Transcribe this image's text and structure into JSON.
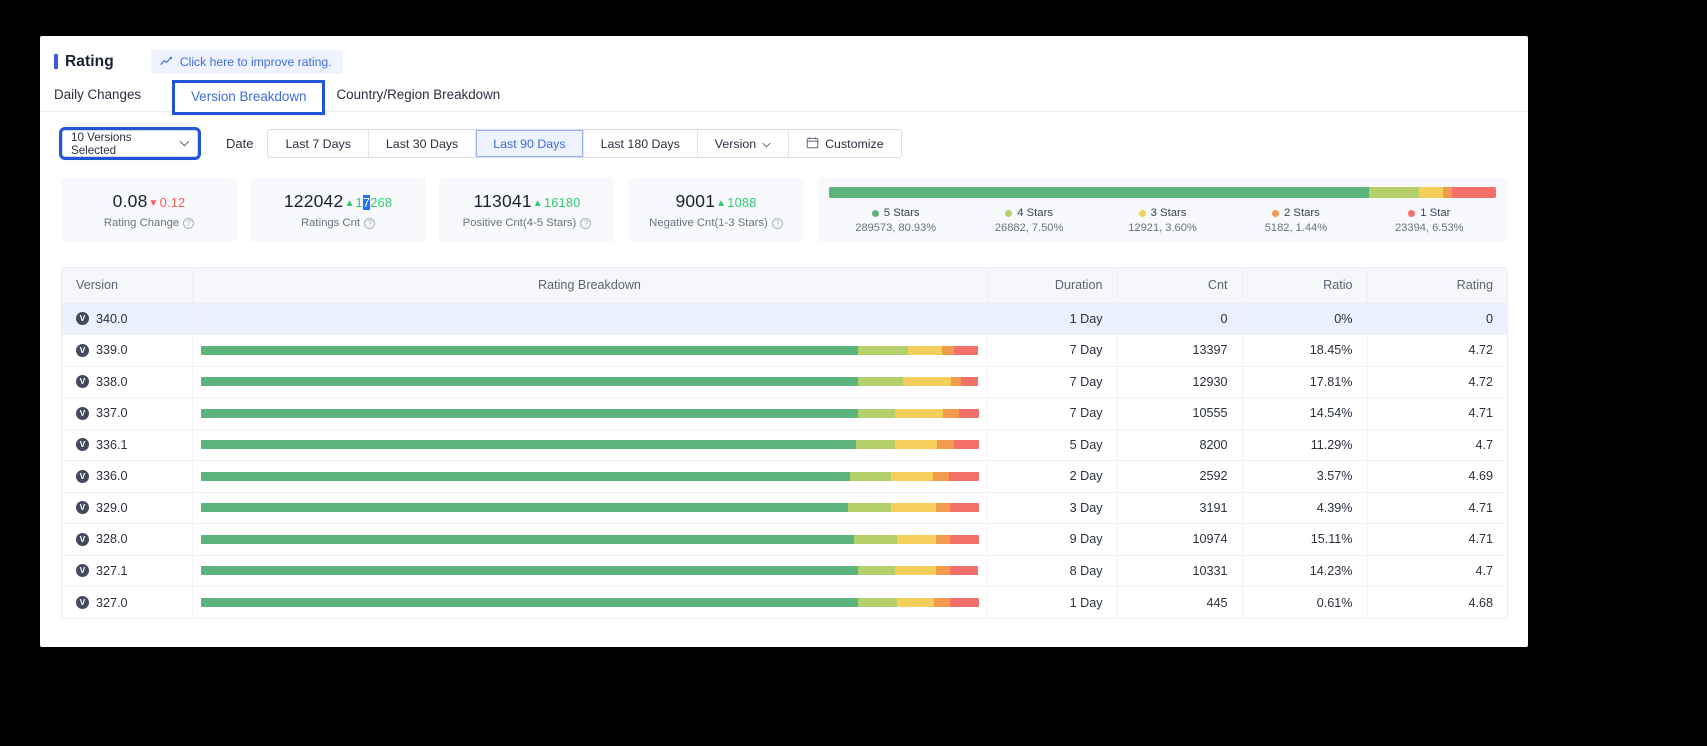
{
  "header": {
    "title": "Rating",
    "improve_cta": "Click here to improve rating.",
    "improve_icon": "line-chart-icon"
  },
  "tabs": [
    {
      "label": "Daily Changes",
      "selected": false
    },
    {
      "label": "Version Breakdown",
      "selected": true
    },
    {
      "label": "Country/Region Breakdown",
      "selected": false
    }
  ],
  "filters": {
    "version_select_value": "10 Versions Selected",
    "chevron_icon": "chevron-down-icon",
    "date_label": "Date",
    "ranges": [
      {
        "label": "Last 7 Days",
        "active": false
      },
      {
        "label": "Last 30 Days",
        "active": false
      },
      {
        "label": "Last 90 Days",
        "active": true
      },
      {
        "label": "Last 180 Days",
        "active": false
      },
      {
        "label": "Version",
        "active": false,
        "caret": "⌄"
      },
      {
        "label": "Customize",
        "active": false,
        "icon": "calendar-icon"
      }
    ]
  },
  "kpis": [
    {
      "value": "0.08",
      "delta": "0.12",
      "direction": "down",
      "arrow": "▼",
      "label": "Rating Change",
      "help_icon": "question-icon"
    },
    {
      "value": "122042",
      "delta_pre": "1",
      "delta_sel": "7",
      "delta_post": "268",
      "direction": "up",
      "arrow": "▲",
      "label": "Ratings Cnt",
      "help_icon": "question-icon"
    },
    {
      "value": "113041",
      "delta": "16180",
      "direction": "up",
      "arrow": "▲",
      "label": "Positive Cnt(4-5 Stars)",
      "help_icon": "question-icon"
    },
    {
      "value": "9001",
      "delta": "1088",
      "direction": "up",
      "arrow": "▲",
      "label": "Negative Cnt(1-3 Stars)",
      "help_icon": "question-icon"
    }
  ],
  "stars": {
    "items": [
      {
        "label": "5 Stars",
        "sub": "289573, 80.93%",
        "pct": 80.93,
        "color": "#5cb47c"
      },
      {
        "label": "4 Stars",
        "sub": "26882, 7.50%",
        "pct": 7.5,
        "color": "#b5cf6b"
      },
      {
        "label": "3 Stars",
        "sub": "12921, 3.60%",
        "pct": 3.6,
        "color": "#f5cf5b"
      },
      {
        "label": "2 Stars",
        "sub": "5182, 1.44%",
        "pct": 1.44,
        "color": "#f29a4d"
      },
      {
        "label": "1 Star",
        "sub": "23394, 6.53%",
        "pct": 6.53,
        "color": "#f4706b"
      }
    ]
  },
  "table": {
    "columns": [
      "Version",
      "Rating Breakdown",
      "Duration",
      "Cnt",
      "Ratio",
      "Rating"
    ],
    "version_badge": "V",
    "rows": [
      {
        "version": "340.0",
        "dist": [
          0,
          0,
          0,
          0,
          0
        ],
        "duration": "1 Day",
        "cnt": "0",
        "ratio": "0%",
        "rating": "0",
        "highlight": true
      },
      {
        "version": "339.0",
        "dist": [
          84.5,
          6.5,
          4.3,
          1.5,
          3.2
        ],
        "duration": "7 Day",
        "cnt": "13397",
        "ratio": "18.45%",
        "rating": "4.72",
        "highlight": false
      },
      {
        "version": "338.0",
        "dist": [
          84.5,
          5.8,
          6.2,
          1.3,
          2.2
        ],
        "duration": "7 Day",
        "cnt": "12930",
        "ratio": "17.81%",
        "rating": "4.72",
        "highlight": false
      },
      {
        "version": "337.0",
        "dist": [
          84.5,
          4.8,
          6.2,
          2.0,
          2.5
        ],
        "duration": "7 Day",
        "cnt": "10555",
        "ratio": "14.54%",
        "rating": "4.71",
        "highlight": false
      },
      {
        "version": "336.1",
        "dist": [
          84.3,
          5.0,
          5.3,
          2.2,
          3.2
        ],
        "duration": "5 Day",
        "cnt": "8200",
        "ratio": "11.29%",
        "rating": "4.7",
        "highlight": false
      },
      {
        "version": "336.0",
        "dist": [
          83.5,
          5.2,
          5.5,
          2.0,
          3.8
        ],
        "duration": "2 Day",
        "cnt": "2592",
        "ratio": "3.57%",
        "rating": "4.69",
        "highlight": false
      },
      {
        "version": "329.0",
        "dist": [
          83.2,
          5.5,
          5.8,
          1.8,
          3.7
        ],
        "duration": "3 Day",
        "cnt": "3191",
        "ratio": "4.39%",
        "rating": "4.71",
        "highlight": false
      },
      {
        "version": "328.0",
        "dist": [
          84.0,
          5.5,
          5.0,
          1.8,
          3.7
        ],
        "duration": "9 Day",
        "cnt": "10974",
        "ratio": "15.11%",
        "rating": "4.71",
        "highlight": false
      },
      {
        "version": "327.1",
        "dist": [
          84.5,
          4.8,
          5.2,
          1.8,
          3.7
        ],
        "duration": "8 Day",
        "cnt": "10331",
        "ratio": "14.23%",
        "rating": "4.7",
        "highlight": false
      },
      {
        "version": "327.0",
        "dist": [
          84.5,
          5.0,
          4.8,
          2.0,
          3.7
        ],
        "duration": "1 Day",
        "cnt": "445",
        "ratio": "0.61%",
        "rating": "4.68",
        "highlight": false
      }
    ]
  },
  "colors": {
    "accent": "#3d6ce0",
    "focus_outline": "#1f55d6",
    "positive": "#2ecc71",
    "negative": "#ff5b5b",
    "star5": "#5cb47c",
    "star4": "#b5cf6b",
    "star3": "#f5cf5b",
    "star2": "#f29a4d",
    "star1": "#f4706b"
  }
}
